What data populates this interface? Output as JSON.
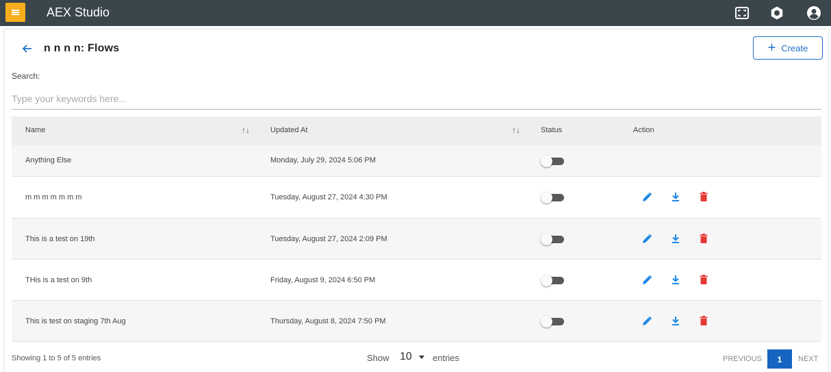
{
  "app": {
    "title": "AEX Studio"
  },
  "toolbar": {
    "menu_icon": "menu-icon",
    "fullscreen_icon": "fullscreen-icon",
    "settings_icon": "settings-icon",
    "account_icon": "account-icon"
  },
  "page": {
    "title": "n n n n: Flows",
    "create_label": "Create"
  },
  "search": {
    "label": "Search:",
    "placeholder": "Type your keywords here...",
    "value": ""
  },
  "table": {
    "columns": {
      "name": "Name",
      "updated_at": "Updated At",
      "status": "Status",
      "action": "Action"
    },
    "sort_glyph": "↑↓",
    "rows": [
      {
        "name": "Anything Else",
        "updated_at": "Monday, July 29, 2024 5:06 PM",
        "status_enabled": false,
        "has_actions": false
      },
      {
        "name": "m m m m m m m",
        "updated_at": "Tuesday, August 27, 2024 4:30 PM",
        "status_enabled": false,
        "has_actions": true
      },
      {
        "name": "This is a test on 19th",
        "updated_at": "Tuesday, August 27, 2024 2:09 PM",
        "status_enabled": false,
        "has_actions": true
      },
      {
        "name": "THis is a test on 9th",
        "updated_at": "Friday, August 9, 2024 6:50 PM",
        "status_enabled": false,
        "has_actions": true
      },
      {
        "name": "This is test on staging 7th Aug",
        "updated_at": "Thursday, August 8, 2024 7:50 PM",
        "status_enabled": false,
        "has_actions": true
      }
    ]
  },
  "footer": {
    "info": "Showing 1 to 5 of 5 entries",
    "show_label": "Show",
    "page_size": "10",
    "entries_label": "entries",
    "previous": "PREVIOUS",
    "current_page": "1",
    "next": "NEXT"
  },
  "colors": {
    "topbar": "#3b454c",
    "menu_button": "#f7ad1e",
    "accent": "#1e88e5",
    "delete": "#e53935",
    "page_active": "#1565c0"
  }
}
